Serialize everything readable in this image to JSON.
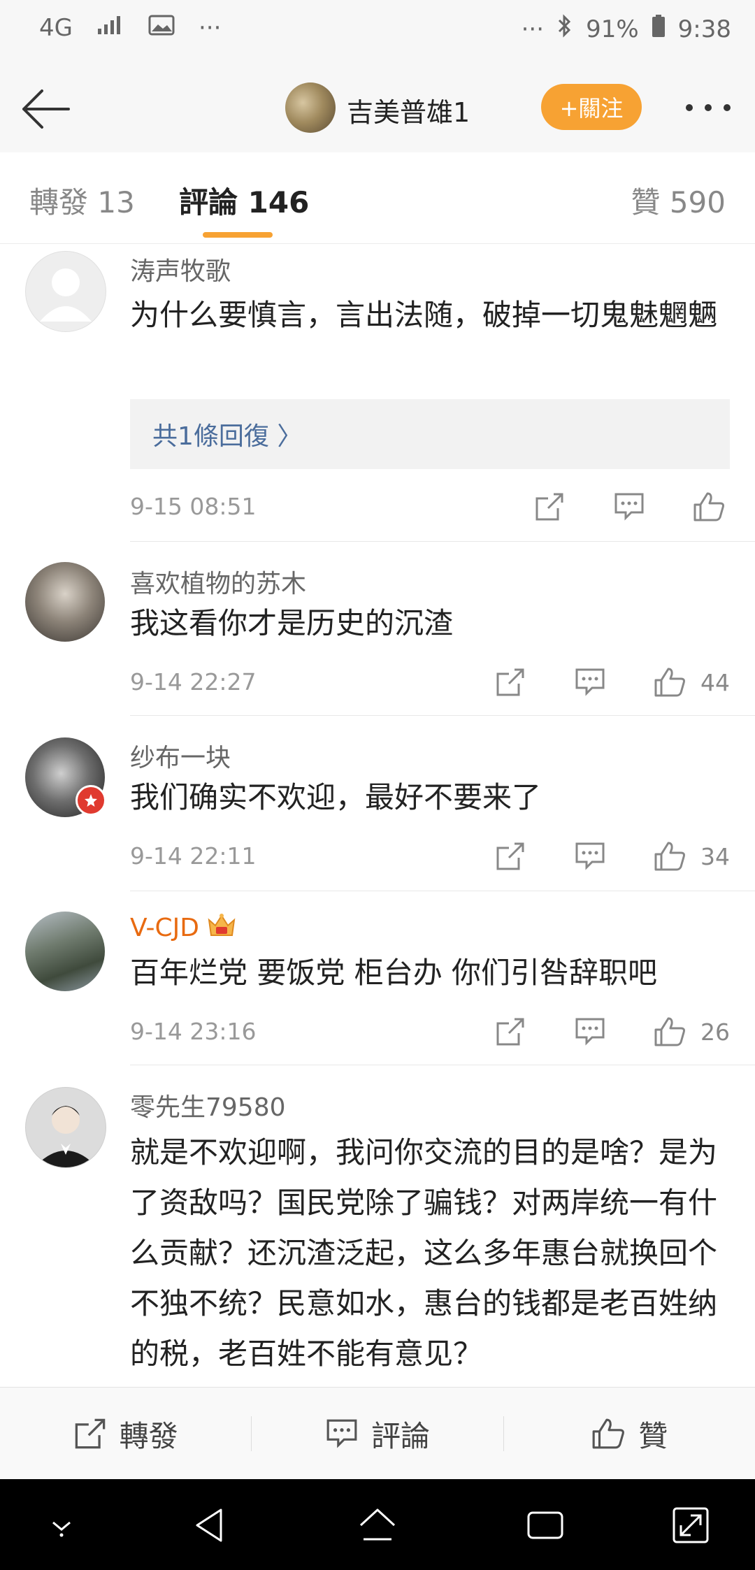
{
  "status_bar": {
    "network": "4G",
    "dots_left": "···",
    "dots_right": "···",
    "battery": "91%",
    "time": "9:38"
  },
  "header": {
    "title": "吉美普雄1",
    "follow_label": "+關注"
  },
  "tabs": {
    "repost": "轉發 13",
    "comments": "評論 146",
    "likes": "贊 590"
  },
  "comments": [
    {
      "user": "涛声牧歌",
      "text": "为什么要慎言，言出法随，破掉一切鬼魅魍魉",
      "reply_link": "共1條回復 〉",
      "time": "9-15 08:51",
      "likes": ""
    },
    {
      "user": "喜欢植物的苏木",
      "text": "我这看你才是历史的沉渣",
      "time": "9-14 22:27",
      "likes": "44"
    },
    {
      "user": "纱布一块",
      "text": "我们确实不欢迎，最好不要来了",
      "time": "9-14 22:11",
      "likes": "34"
    },
    {
      "user": "V-CJD",
      "text": "百年烂党 要饭党 柜台办 你们引咎辞职吧",
      "time": "9-14 23:16",
      "likes": "26"
    },
    {
      "user": "零先生79580",
      "text": "就是不欢迎啊，我问你交流的目的是啥？是为了资敌吗？国民党除了骗钱？对两岸统一有什么贡献？还沉渣泛起，这么多年惠台就换回个不独不统？民意如水，惠台的钱都是老百姓纳的税，老百姓不能有意见？"
    }
  ],
  "bottom_bar": {
    "repost": "轉發",
    "comment": "評論",
    "like": "贊"
  },
  "colors": {
    "accent": "#f7a233",
    "vip_name": "#e86a10",
    "link": "#4b6d9c"
  }
}
